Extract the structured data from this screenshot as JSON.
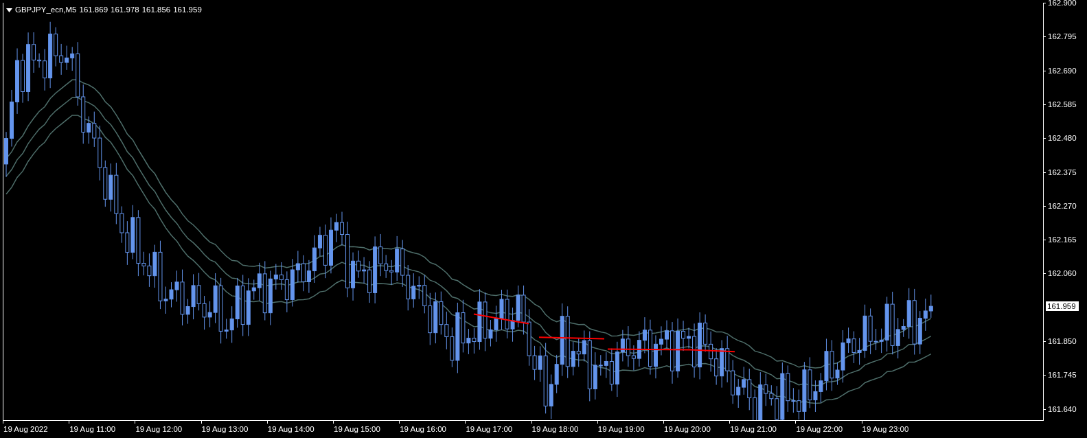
{
  "chart_header": {
    "symbol": "GBPJPY_ecn,M5",
    "quotes": [
      "161.869",
      "161.978",
      "161.856",
      "161.959"
    ]
  },
  "price_axis": {
    "labels": [
      "162.900",
      "162.795",
      "162.690",
      "162.585",
      "162.480",
      "162.375",
      "162.270",
      "162.165",
      "162.060",
      "161.850",
      "161.745",
      "161.640"
    ],
    "current_price": "161.959"
  },
  "time_axis": {
    "labels": [
      "19 Aug 2022",
      "19 Aug 11:00",
      "19 Aug 12:00",
      "19 Aug 13:00",
      "19 Aug 14:00",
      "19 Aug 15:00",
      "19 Aug 16:00",
      "19 Aug 17:00",
      "19 Aug 18:00",
      "19 Aug 19:00",
      "19 Aug 20:00",
      "19 Aug 21:00",
      "19 Aug 22:00",
      "19 Aug 23:00"
    ]
  }
}
